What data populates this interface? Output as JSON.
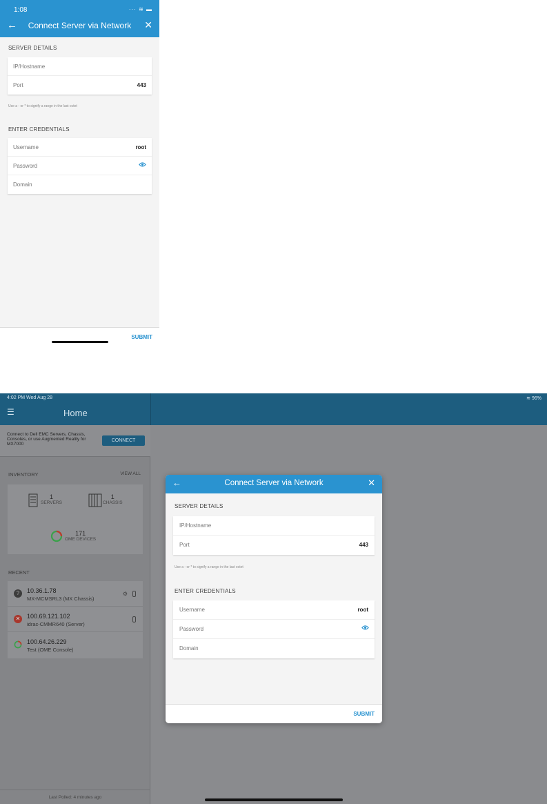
{
  "phone": {
    "status": {
      "time": "1:08",
      "icons": "··· ≋ ▬"
    },
    "header": {
      "title": "Connect Server via Network"
    },
    "server_details": {
      "section_label": "SERVER DETAILS",
      "fields": [
        {
          "label": "IP/Hostname",
          "value": ""
        },
        {
          "label": "Port",
          "value": "443"
        }
      ],
      "hint": "Use a - or * to signify a range in the last octet"
    },
    "credentials": {
      "section_label": "ENTER CREDENTIALS",
      "fields": [
        {
          "label": "Username",
          "value": "root"
        },
        {
          "label": "Password",
          "value": ""
        },
        {
          "label": "Domain",
          "value": ""
        }
      ]
    },
    "submit_label": "SUBMIT"
  },
  "tablet": {
    "status": {
      "time": "4:02 PM  Wed Aug 28",
      "battery": "≋ 96%"
    },
    "nav_title": "Home",
    "connect": {
      "text": "Connect to Dell EMC Servers, Chassis, Consoles, or use Augmented Reality for MX7000",
      "button": "CONNECT"
    },
    "inventory": {
      "label": "INVENTORY",
      "view_all": "VIEW ALL",
      "servers": {
        "count": "1",
        "caption": "SERVERS"
      },
      "chassis": {
        "count": "1",
        "caption": "CHASSIS"
      },
      "ome": {
        "count": "171",
        "caption": "OME DEVICES"
      }
    },
    "recent": {
      "label": "RECENT",
      "items": [
        {
          "ip": "10.36.1.78",
          "name": "MX-MCMSRL3 (MX Chassis)"
        },
        {
          "ip": "100.69.121.102",
          "name": "idrac-CMMR640 (Server)"
        },
        {
          "ip": "100.64.26.229",
          "name": "Test (OME Console)"
        }
      ]
    },
    "last_polled": "Last Polled: 4 minutes ago",
    "modal": {
      "title": "Connect Server via Network",
      "server_details": {
        "section_label": "SERVER DETAILS",
        "fields": [
          {
            "label": "IP/Hostname",
            "value": ""
          },
          {
            "label": "Port",
            "value": "443"
          }
        ],
        "hint": "Use a - or * to signify a range in the last octet"
      },
      "credentials": {
        "section_label": "ENTER CREDENTIALS",
        "fields": [
          {
            "label": "Username",
            "value": "root"
          },
          {
            "label": "Password",
            "value": ""
          },
          {
            "label": "Domain",
            "value": ""
          }
        ]
      },
      "submit_label": "SUBMIT"
    }
  },
  "colors": {
    "accent": "#2a93d0",
    "tablet_nav": "#1d5d7f",
    "status_critical": "#c0392b",
    "status_ok": "#3aa14a",
    "status_warning": "#e67e22"
  }
}
